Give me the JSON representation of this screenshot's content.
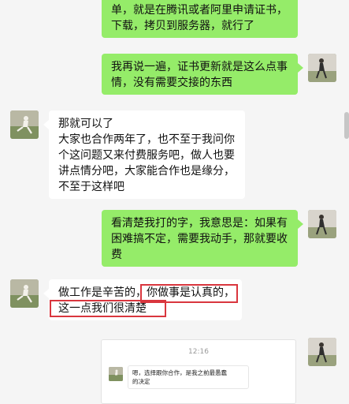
{
  "messages": [
    {
      "side": "right",
      "lines": [
        "单，就是在腾讯或者阿里申请证书，",
        "下载，拷贝到服务器，就行了"
      ]
    },
    {
      "side": "right",
      "lines": [
        "我再说一遍，证书更新就是这么点事",
        "情，没有需要交接的东西"
      ]
    },
    {
      "side": "left",
      "lines": [
        "那就可以了",
        "大家也合作两年了，也不至于我问你",
        "个这问题又来付费服务吧，做人也要",
        "讲点情分吧，大家能合作也是缘分，",
        "不至于这样吧"
      ]
    },
    {
      "side": "right",
      "lines": [
        "看清楚我打的字，我意思是：如果有",
        "困难搞不定，需要我动手，那就要收",
        "费"
      ]
    },
    {
      "side": "left",
      "lines": [
        "做工作是辛苦的，你做事是认真的，",
        "这一点我们很清楚"
      ]
    }
  ],
  "quoted_card": {
    "time": "12:16",
    "lines": [
      "嗯，选择跟你合作，是我之前最愚蠢",
      "的决定"
    ]
  },
  "colors": {
    "sent_bubble": "#95ec69",
    "received_bubble": "#ffffff",
    "highlight_box": "#d9363e",
    "background": "#f5f5f5"
  }
}
